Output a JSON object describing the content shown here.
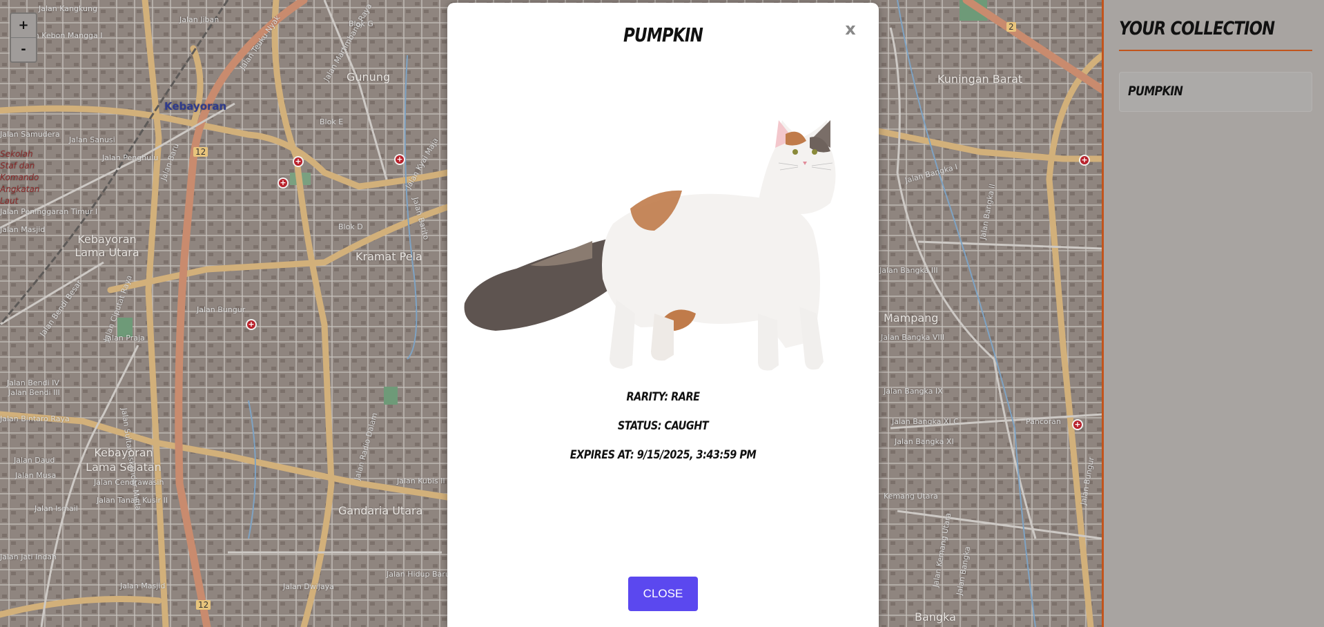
{
  "map": {
    "zoom_in_label": "+",
    "zoom_out_label": "-",
    "labels": [
      "Jalan Kangkung",
      "Jalan Kebon Mangga I",
      "Jalan Jiban",
      "Jalan Teuku Nyak",
      "Blok G",
      "Jalan Martimbang Raya",
      "Gunung",
      "Kebayoran",
      "Blok E",
      "Jalan Samudera",
      "Jalan Sanusi",
      "Jalan Penghulu",
      "Jalan Baru",
      "Jalan Kyai Maja",
      "Jalan Peninggaran Timur I",
      "Jalan Masjid",
      "Kebayoran Lama Utara",
      "Blok D",
      "Kramat Pela",
      "Jalan Barito",
      "Jalan Ciputat Raya",
      "Jalan Bendi Besar",
      "Jalan Bungur",
      "Jalan Praja",
      "Jalan Bendi IV",
      "Jalan Bendi III",
      "Jalan Bintaro Raya",
      "Jalan Sultan Iskandar Muda",
      "Kebayoran Lama Selatan",
      "Jalan Cendrawasih",
      "Jalan Daud",
      "Jalan Musa",
      "Jalan Ismail",
      "Jalan Tanah Kusir II",
      "Jalan Radio Dalam",
      "Gandaria Utara",
      "Jalan Kubis II",
      "Jalan Jati Indah",
      "Jalan Masjid",
      "Jalan Dwijaya",
      "Jalan Hidup Baru",
      "Kuningan Barat",
      "Jalan Bangka I",
      "Jalan Bangka II",
      "Jalan Bangka III",
      "Mampang",
      "Jalan Bangka VIII",
      "Jalan Bangka IX",
      "Jalan Bangka XI C",
      "Jalan Bangka XI",
      "Pancoran",
      "Kemang Utara",
      "Jalan Kemang Utara",
      "Jalan Bangka",
      "Jalan Bungur",
      "Bangka"
    ],
    "school_label": "Sekolah Staf dan Komando Angkatan Laut",
    "road_numbers": [
      "12",
      "12",
      "2"
    ],
    "colors": {
      "base": "#8f857f",
      "major_road": "#c98b6e",
      "secondary_road": "#d2b07a",
      "minor_road": "#c9c4bf",
      "pin": "#b8212b"
    }
  },
  "modal": {
    "title": "Pumpkin",
    "close_x": "x",
    "image_icon": "calico-cat-illustration",
    "rarity": "Rarity: Rare",
    "status": "Status: Caught",
    "expires": "Expires At: 9/15/2025, 3:43:59 PM",
    "close_button": "Close",
    "button_color": "#5b48ef"
  },
  "sidebar": {
    "title": "Your Collection",
    "items": [
      {
        "label": "Pumpkin"
      }
    ],
    "accent": "#c2541c"
  }
}
